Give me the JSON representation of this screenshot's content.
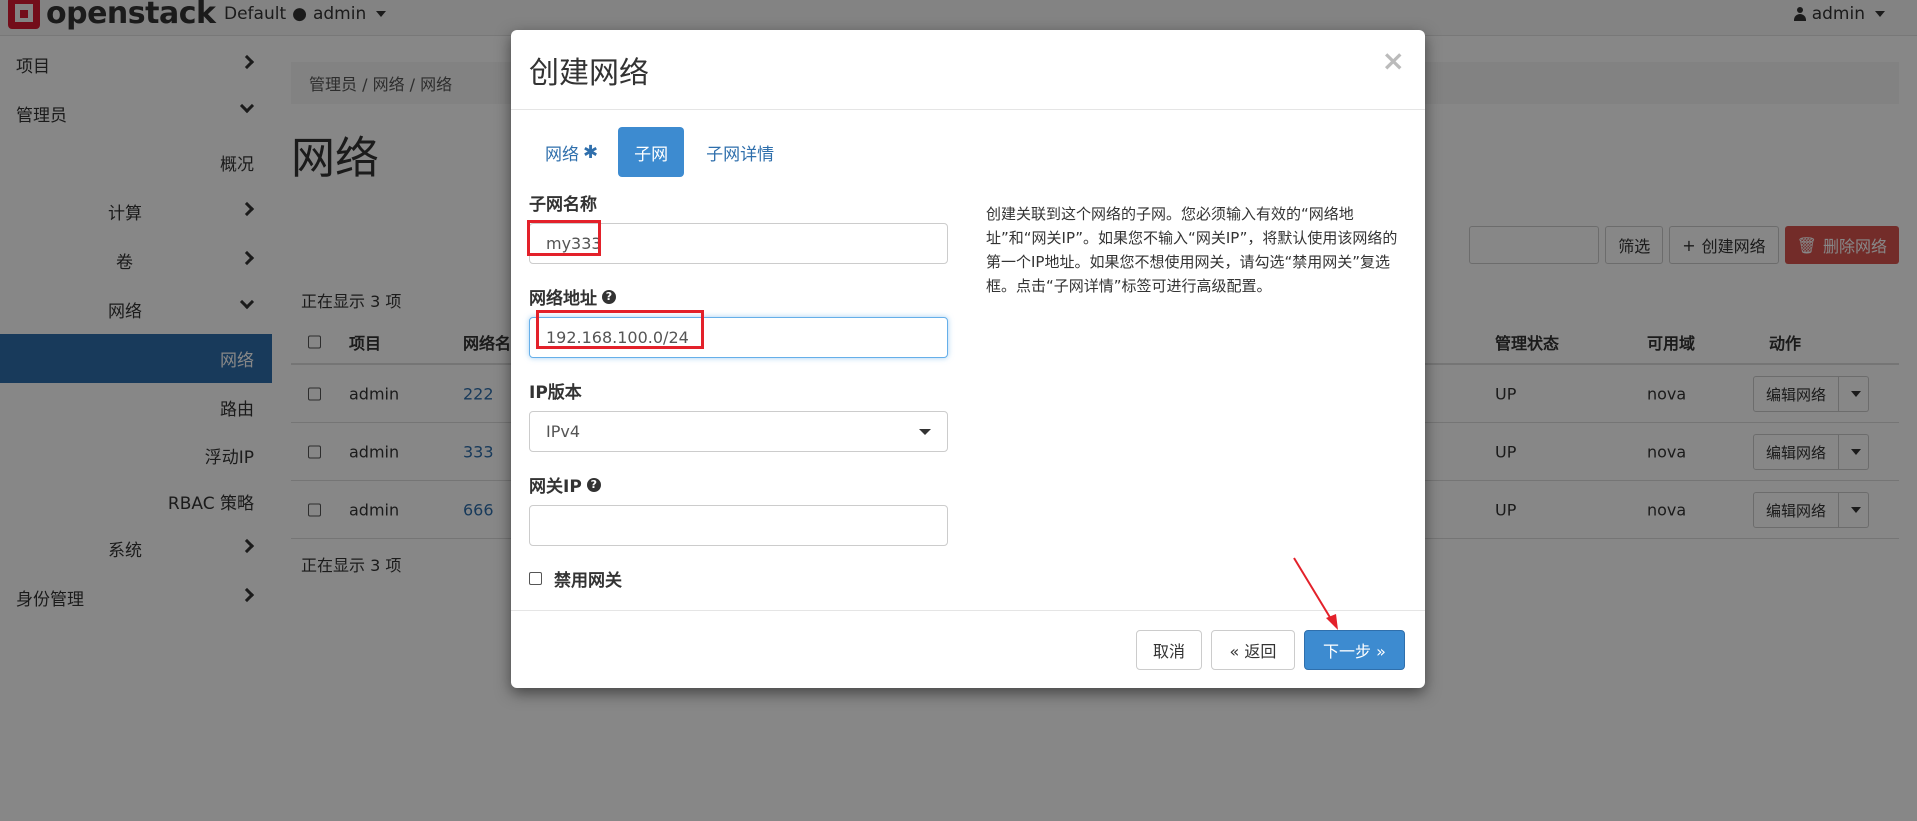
{
  "topbar": {
    "brand": "openstack",
    "domain_label": "Default",
    "project_label": "admin",
    "user_label": "admin"
  },
  "sidebar": {
    "items": [
      {
        "label": "项目"
      },
      {
        "label": "管理员"
      },
      {
        "label": "概况"
      },
      {
        "label": "计算"
      },
      {
        "label": "卷"
      },
      {
        "label": "网络"
      },
      {
        "label": "网络"
      },
      {
        "label": "路由"
      },
      {
        "label": "浮动IP"
      },
      {
        "label": "RBAC 策略"
      },
      {
        "label": "系统"
      },
      {
        "label": "身份管理"
      }
    ]
  },
  "main": {
    "breadcrumb": "管理员  /  网络  /  网络",
    "title": "网络",
    "filter_label": "筛选",
    "create_label": "创建网络",
    "delete_label": "删除网络",
    "showing": "正在显示 3 项",
    "columns": [
      "项目",
      "网络名",
      "管理状态",
      "可用域",
      "动作"
    ],
    "rows": [
      {
        "project": "admin",
        "name": "222",
        "state": "UP",
        "zone": "nova",
        "action": "编辑网络"
      },
      {
        "project": "admin",
        "name": "333",
        "state": "UP",
        "zone": "nova",
        "action": "编辑网络"
      },
      {
        "project": "admin",
        "name": "666",
        "state": "UP",
        "zone": "nova",
        "action": "编辑网络"
      }
    ]
  },
  "modal": {
    "title": "创建网络",
    "close": "×",
    "tabs": [
      {
        "label": "网络",
        "required": "✱"
      },
      {
        "label": "子网"
      },
      {
        "label": "子网详情"
      }
    ],
    "subnet_name_label": "子网名称",
    "subnet_name_value": "my333",
    "network_address_label": "网络地址",
    "network_address_value": "192.168.100.0/24",
    "ip_version_label": "IP版本",
    "ip_version_value": "IPv4",
    "gateway_label": "网关IP",
    "gateway_value": "",
    "disable_gateway_label": "禁用网关",
    "description": "创建关联到这个网络的子网。您必须输入有效的“网络地址”和“网关IP”。如果您不输入“网关IP”，将默认使用该网络的第一个IP地址。如果您不想使用网关，请勾选“禁用网关”复选框。点击“子网详情”标签可进行高级配置。",
    "cancel_label": "取消",
    "back_label": "« 返回",
    "next_label": "下一步 »"
  },
  "colors": {
    "primary": "#3d8bd0",
    "sidebar_active": "#2f6fac",
    "danger": "#d9534f",
    "highlight": "#e3212a",
    "brand_red": "#da1a32"
  }
}
